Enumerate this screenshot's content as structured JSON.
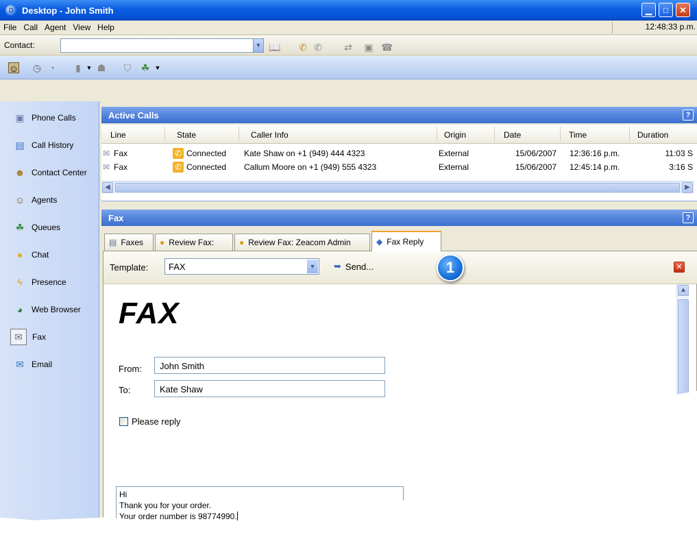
{
  "window": {
    "title": "Desktop - John Smith",
    "app_icon": "D"
  },
  "title_buttons": {
    "minimize": "▁",
    "maximize": "□",
    "close": "✕"
  },
  "menu": [
    "File",
    "Call",
    "Agent",
    "View",
    "Help"
  ],
  "clock": "12:48:33 p.m.",
  "contact": {
    "label": "Contact:",
    "value": ""
  },
  "sidebar": {
    "items": [
      {
        "label": "Phone Calls",
        "icon": "phone-calls-icon"
      },
      {
        "label": "Call History",
        "icon": "call-history-icon"
      },
      {
        "label": "Contact Center",
        "icon": "contact-center-icon"
      },
      {
        "label": "Agents",
        "icon": "agents-icon"
      },
      {
        "label": "Queues",
        "icon": "queues-icon"
      },
      {
        "label": "Chat",
        "icon": "chat-icon"
      },
      {
        "label": "Presence",
        "icon": "presence-icon"
      },
      {
        "label": "Web Browser",
        "icon": "web-browser-icon"
      },
      {
        "label": "Fax",
        "icon": "fax-icon",
        "selected": true
      },
      {
        "label": "Email",
        "icon": "email-icon"
      }
    ]
  },
  "active_calls": {
    "title": "Active Calls",
    "help": "?",
    "columns": [
      "Line",
      "State",
      "Caller Info",
      "Origin",
      "Date",
      "Time",
      "Duration"
    ],
    "rows": [
      {
        "line": "Fax",
        "state": "Connected",
        "caller": "Kate Shaw on +1 (949) 444 4323",
        "origin": "External",
        "date": "15/06/2007",
        "time": "12:36:16 p.m.",
        "duration": "11:03 S"
      },
      {
        "line": "Fax",
        "state": "Connected",
        "caller": "Callum Moore on +1 (949) 555 4323",
        "origin": "External",
        "date": "15/06/2007",
        "time": "12:45:14 p.m.",
        "duration": "3:16 S"
      }
    ]
  },
  "fax_panel": {
    "title": "Fax",
    "help": "?",
    "tabs": [
      {
        "label": "Faxes",
        "icon": "faxes-icon"
      },
      {
        "label": "Review Fax:",
        "icon": "review-fax-icon"
      },
      {
        "label": "Review Fax: Zeacom Admin",
        "icon": "review-fax-icon"
      },
      {
        "label": "Fax Reply",
        "icon": "fax-reply-icon",
        "active": true
      }
    ],
    "template_label": "Template:",
    "template_value": "FAX",
    "send_label": "Send...",
    "callout_number": "1",
    "doc_title": "FAX",
    "from_label": "From:",
    "from_value": "John Smith",
    "to_label": "To:",
    "to_value": "Kate Shaw",
    "please_reply_label": "Please reply",
    "please_reply_checked": false,
    "message_lines": [
      "Hi",
      "Thank you for your order.",
      "Your order number is 98774990."
    ]
  },
  "colors": {
    "title_bar": "#0553d6",
    "header_blue": "#5384dc",
    "sidebar": "#c3d5f5",
    "accent_orange": "#f0a030"
  }
}
